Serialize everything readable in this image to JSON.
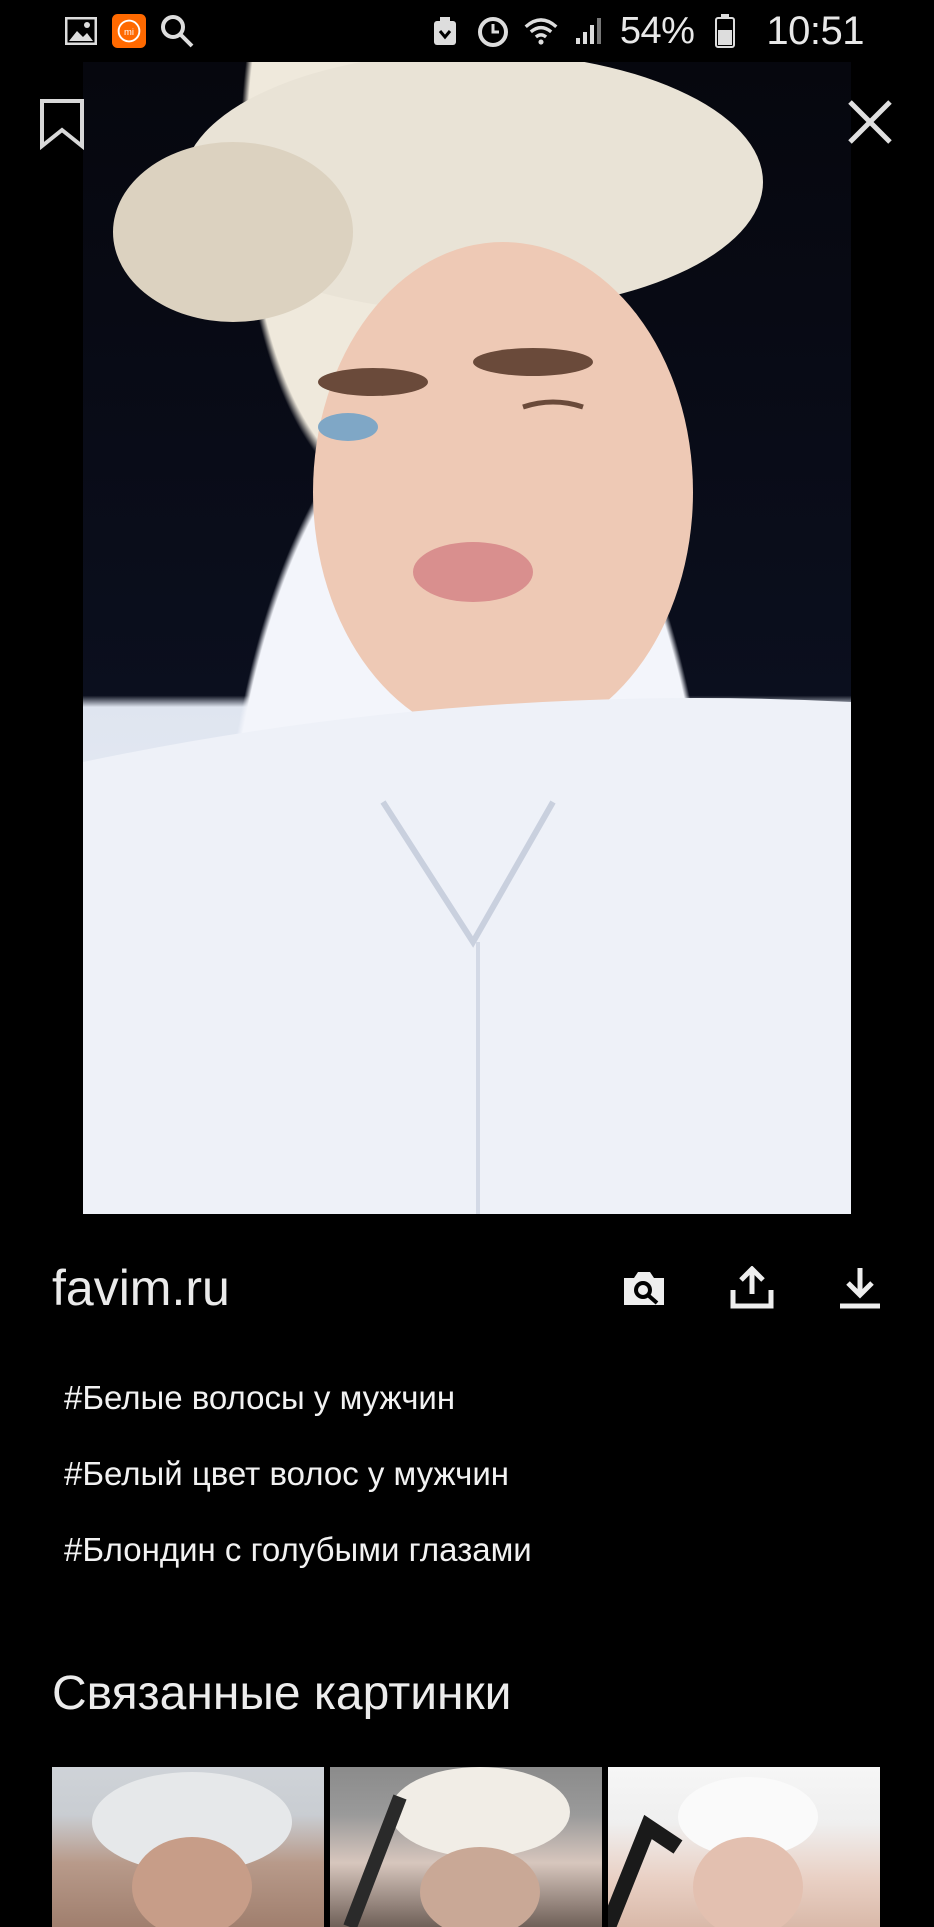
{
  "status_bar": {
    "left_icons": [
      "gallery-icon",
      "mi-app-icon",
      "search-icon"
    ],
    "right_icons": [
      "notification-icon",
      "alarm-icon",
      "wifi-icon",
      "signal-icon",
      "battery-icon"
    ],
    "battery_percent": "54%",
    "time": "10:51"
  },
  "viewer": {
    "source": "favim.ru",
    "actions": [
      "camera-search-icon",
      "share-icon",
      "download-icon"
    ]
  },
  "tags": [
    "#Белые волосы у мужчин",
    "#Белый цвет волос у мужчин",
    "#Блондин с голубыми глазами"
  ],
  "related": {
    "title": "Связанные картинки",
    "count": 3
  }
}
